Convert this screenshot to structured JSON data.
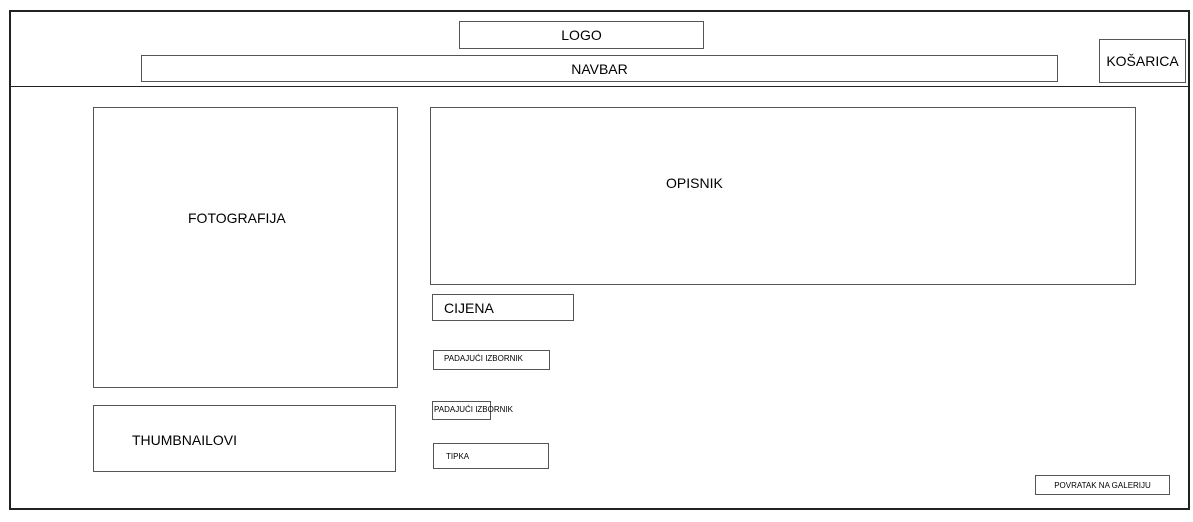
{
  "header": {
    "logo": "LOGO",
    "navbar": "NAVBAR",
    "cart": "KOŠARICA"
  },
  "product": {
    "photo": "FOTOGRAFIJA",
    "thumbnails": "THUMBNAILOVI",
    "description": "OPISNIK",
    "price": "CIJENA",
    "dropdown_1": "PADAJUĆI IZBORNIK",
    "dropdown_2": "PADAJUĆI IZBORNIK",
    "button": "TIPKA"
  },
  "footer": {
    "back_to_gallery": "POVRATAK NA GALERIJU"
  }
}
